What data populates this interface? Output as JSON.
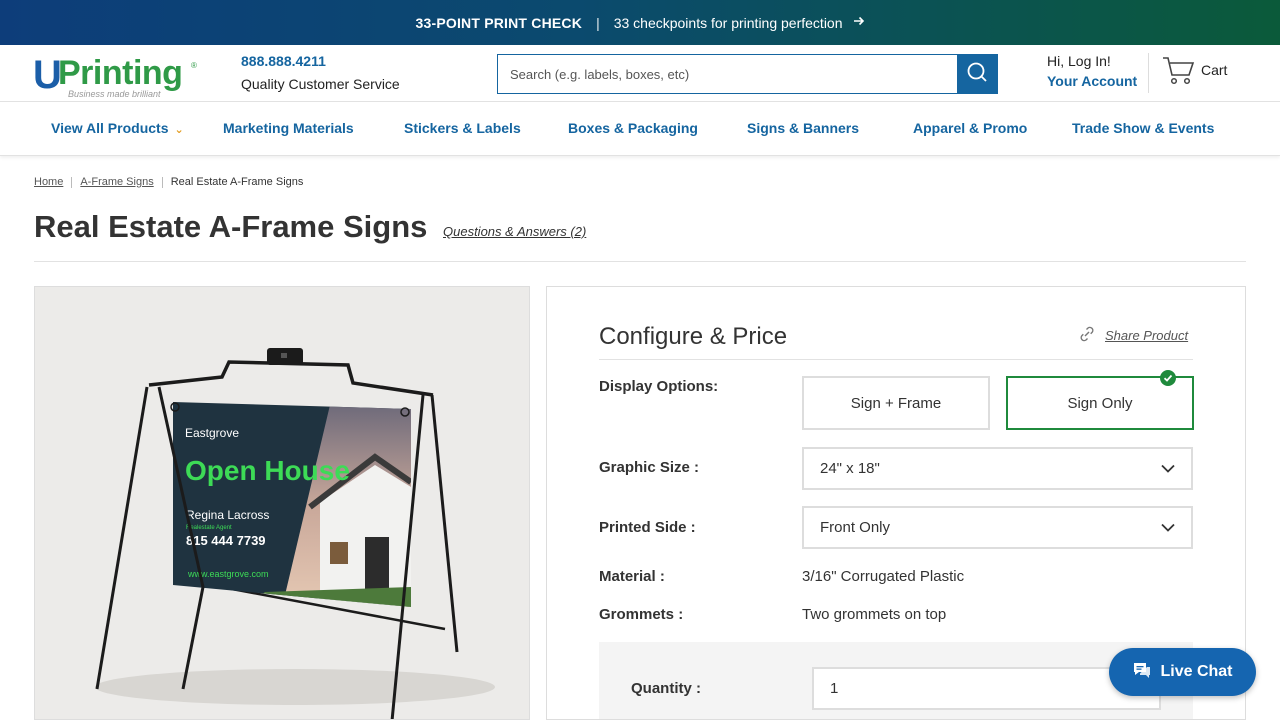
{
  "promo": {
    "headline": "33-POINT PRINT CHECK",
    "separator": "|",
    "text": "33 checkpoints for printing perfection"
  },
  "header": {
    "logo_u": "U",
    "logo_word": "Printing",
    "logo_tagline": "Business made brilliant",
    "phone": "888.888.4211",
    "service": "Quality Customer Service",
    "search_placeholder": "Search (e.g. labels, boxes, etc)",
    "greeting": "Hi, Log In!",
    "account": "Your Account",
    "cart": "Cart"
  },
  "nav": {
    "items": [
      "View All Products",
      "Marketing Materials",
      "Stickers & Labels",
      "Boxes & Packaging",
      "Signs & Banners",
      "Apparel & Promo",
      "Trade Show & Events"
    ]
  },
  "breadcrumb": [
    "Home",
    "A-Frame Signs",
    "Real Estate A-Frame Signs"
  ],
  "page": {
    "title": "Real Estate A-Frame Signs",
    "qa_link": "Questions & Answers (2)"
  },
  "sign": {
    "brand": "Eastgrove",
    "headline": "Open House",
    "agent": "Regina Lacross",
    "role": "Realestate Agent",
    "phone": "815 444 7739",
    "web": "www.eastgrove.com"
  },
  "config": {
    "title": "Configure & Price",
    "share": "Share Product",
    "display_label": "Display Options:",
    "display_options": [
      "Sign + Frame",
      "Sign Only"
    ],
    "display_selected": "Sign Only",
    "size_label": "Graphic Size :",
    "size_value": "24\" x 18\"",
    "side_label": "Printed Side :",
    "side_value": "Front Only",
    "material_label": "Material :",
    "material_value": "3/16\" Corrugated Plastic",
    "grommets_label": "Grommets :",
    "grommets_value": "Two grommets on top",
    "quantity_label": "Quantity :",
    "quantity_value": "1"
  },
  "chat": {
    "label": "Live Chat"
  },
  "colors": {
    "brand_blue": "#1565a0",
    "brand_green": "#2f9a47",
    "selected": "#1f8a3c",
    "chevron": "#e29a1b"
  }
}
